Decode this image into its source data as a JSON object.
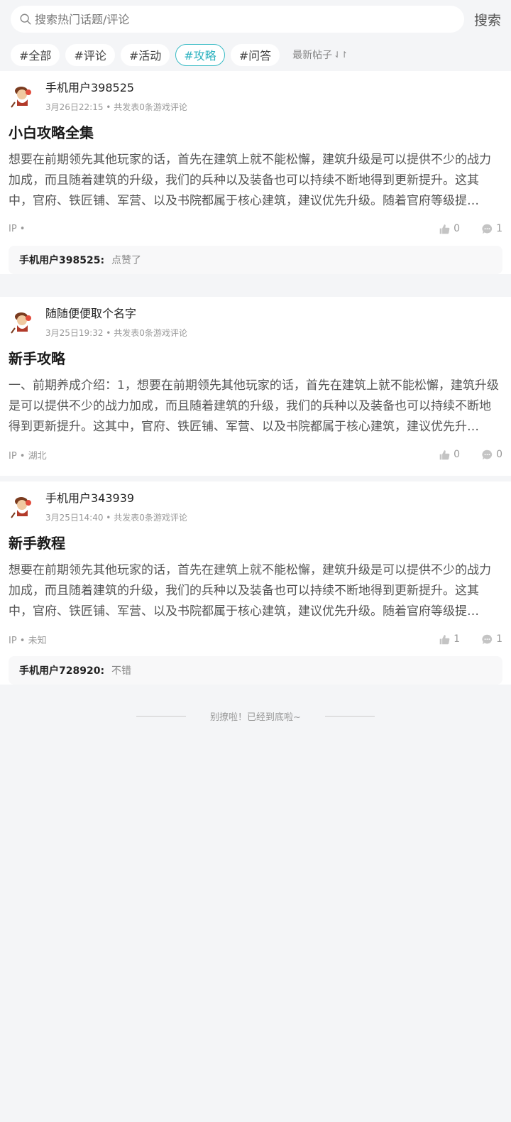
{
  "search": {
    "placeholder": "搜索热门话题/评论",
    "button": "搜索"
  },
  "tabs": [
    "#全部",
    "#评论",
    "#活动",
    "#攻略",
    "#问答"
  ],
  "sort_label": "最新帖子",
  "posts": [
    {
      "author": "手机用户398525",
      "meta": "3月26日22:15 • 共发表0条游戏评论",
      "title": "小白攻略全集",
      "body": "想要在前期领先其他玩家的话，首先在建筑上就不能松懈，建筑升级是可以提供不少的战力加成，而且随着建筑的升级，我们的兵种以及装备也可以持续不断地得到更新提升。这其中，官府、铁匠铺、军营、以及书院都属于核心建筑，建议优先升级。随着官府等级提升……",
      "ip": "IP •",
      "likes": "0",
      "comments": "1",
      "preview_name": "手机用户398525:",
      "preview_text": "点赞了"
    },
    {
      "author": "随随便便取个名字",
      "meta": "3月25日19:32 • 共发表0条游戏评论",
      "title": "新手攻略",
      "body": "一、前期养成介绍：1，想要在前期领先其他玩家的话，首先在建筑上就不能松懈，建筑升级是可以提供不少的战力加成，而且随着建筑的升级，我们的兵种以及装备也可以持续不断地得到更新提升。这其中，官府、铁匠铺、军营、以及书院都属于核心建筑，建议优先升级……",
      "ip": "IP • 湖北",
      "likes": "0",
      "comments": "0"
    },
    {
      "author": "手机用户343939",
      "meta": "3月25日14:40 • 共发表0条游戏评论",
      "title": "新手教程",
      "body": "想要在前期领先其他玩家的话，首先在建筑上就不能松懈，建筑升级是可以提供不少的战力加成，而且随着建筑的升级，我们的兵种以及装备也可以持续不断地得到更新提升。这其中，官府、铁匠铺、军营、以及书院都属于核心建筑，建议优先升级。随着官府等级提升……",
      "ip": "IP • 未知",
      "likes": "1",
      "comments": "1",
      "preview_name": "手机用户728920:",
      "preview_text": "不错"
    }
  ],
  "bottom_note": "别撩啦！已经到底啦~",
  "colors": {
    "accent": "#2fb3c0",
    "background": "#f4f5f7"
  }
}
